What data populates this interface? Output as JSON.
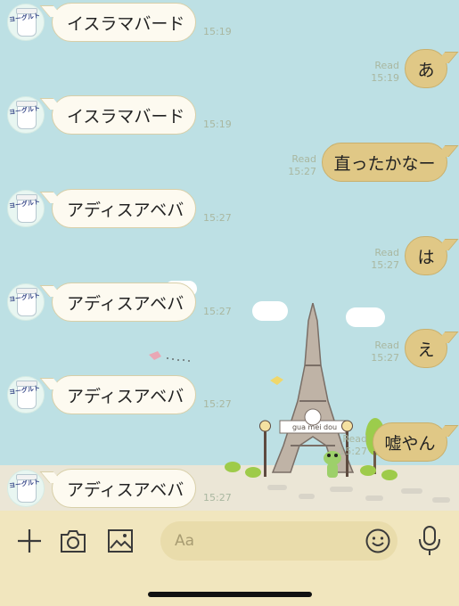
{
  "incoming": [
    {
      "text": "イスラマバード",
      "time": "15:19"
    },
    {
      "text": "イスラマバード",
      "time": "15:19"
    },
    {
      "text": "アディスアベバ",
      "time": "15:27"
    },
    {
      "text": "アディスアベバ",
      "time": "15:27"
    },
    {
      "text": "アディスアベバ",
      "time": "15:27"
    },
    {
      "text": "アディスアベバ",
      "time": "15:27"
    }
  ],
  "outgoing": [
    {
      "text": "あ",
      "read": "Read",
      "time": "15:19"
    },
    {
      "text": "直ったかなー",
      "read": "Read",
      "time": "15:27"
    },
    {
      "text": "は",
      "read": "Read",
      "time": "15:27"
    },
    {
      "text": "え",
      "read": "Read",
      "time": "15:27"
    },
    {
      "text": "嘘やん",
      "read": "Read",
      "time": "15:27"
    }
  ],
  "avatar_label": "ヨーグルト",
  "sign_text": "gua mei dou",
  "input": {
    "placeholder": "Aa"
  },
  "icons": [
    "plus-icon",
    "camera-icon",
    "image-icon",
    "emoji-icon",
    "microphone-icon"
  ],
  "colors": {
    "background": "#bde0e4",
    "incoming_bubble": "#fdfaf0",
    "outgoing_bubble": "#e0c886",
    "toolbar": "#f1e6be"
  }
}
